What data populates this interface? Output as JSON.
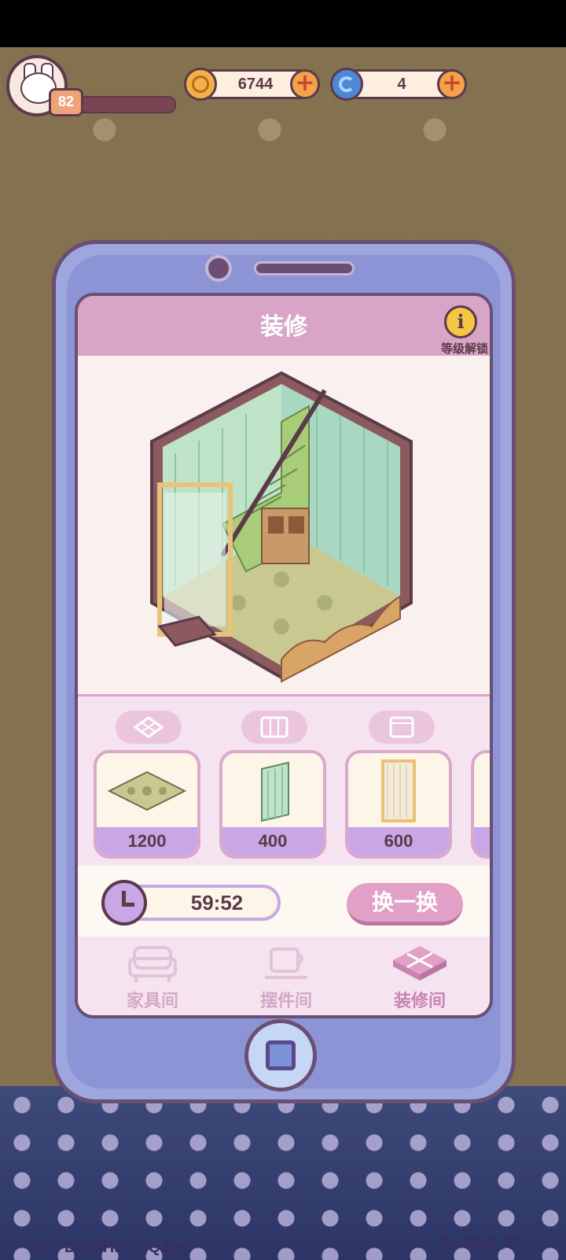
{
  "hud": {
    "level": "82",
    "coins": "6744",
    "gems": "4",
    "coin_plus": "+",
    "gem_plus": "+"
  },
  "panel": {
    "title": "装修",
    "info_symbol": "i",
    "info_label": "等级解锁"
  },
  "categories": [
    "floor-icon",
    "wall-icon",
    "curtain-icon"
  ],
  "items": [
    {
      "name": "floor-tile",
      "price": "1200"
    },
    {
      "name": "wallpaper",
      "price": "400"
    },
    {
      "name": "curtain",
      "price": "600"
    }
  ],
  "refresh": {
    "timer": "59:52",
    "button_label": "换一换"
  },
  "tabs": [
    {
      "label": "家具间",
      "icon": "sofa-icon"
    },
    {
      "label": "摆件间",
      "icon": "cup-icon"
    },
    {
      "label": "装修间",
      "icon": "floor-tile-icon",
      "active": true
    }
  ],
  "footer": {
    "id": "ID：DQWHD...gQJpK",
    "version": "V.1.60.0_52"
  },
  "colors": {
    "panel_header": "#d8a5c6",
    "phone_frame": "#9ea6de",
    "price_bar": "#c9a7e6",
    "outline": "#5b3a4a"
  }
}
